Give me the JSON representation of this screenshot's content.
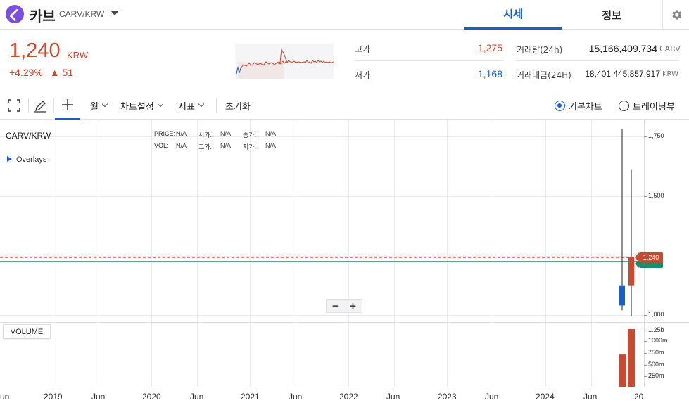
{
  "header": {
    "coin_name": "카브",
    "pair": "CARV/KRW",
    "tabs": [
      "시세",
      "정보"
    ],
    "active_tab": "시세",
    "accent_color": "#1561c8"
  },
  "summary": {
    "price": "1,240",
    "price_unit": "KRW",
    "change_percent": "+4.29%",
    "change_arrow": "▲",
    "change_amount": "51",
    "up_color": "#c84a31",
    "down_color": "#1561c8",
    "high_label": "고가",
    "high_value": "1,275",
    "low_label": "저가",
    "low_value": "1,168",
    "volume_label": "거래량(24h)",
    "volume_value": "15,166,409.734",
    "volume_unit": "CARV",
    "amount_label": "거래대금(24H)",
    "amount_value": "18,401,445,857.917",
    "amount_unit": "KRW"
  },
  "toolbar": {
    "period": "월",
    "chart_settings": "차트설정",
    "indicators": "지표",
    "reset": "초기화",
    "chart_types": [
      "기본차트",
      "트레이딩뷰"
    ],
    "selected_chart_type": "기본차트"
  },
  "chart": {
    "symbol": "CARV/KRW",
    "overlays_label": "Overlays",
    "ohlc_info": [
      {
        "label": "PRICE:",
        "value": "N/A"
      },
      {
        "label": "시가:",
        "value": "N/A"
      },
      {
        "label": "종가:",
        "value": "N/A"
      },
      {
        "label": "VOL:",
        "value": "N/A"
      },
      {
        "label": "고가:",
        "value": "N/A"
      },
      {
        "label": "저가:",
        "value": "N/A"
      }
    ],
    "volume_button": "VOLUME",
    "zoom_minus": "−",
    "zoom_plus": "+",
    "current_price_tag": "1,240"
  },
  "chart_data": {
    "type": "candlestick",
    "price_axis_ticks": [
      "1,750",
      "1,500",
      "1,000"
    ],
    "volume_axis_ticks": [
      "1.25b",
      "1000m",
      "750m",
      "500m",
      "250m"
    ],
    "x_tick_labels": [
      "un",
      "2019",
      "Jun",
      "2020",
      "Jun",
      "2021",
      "Jun",
      "2022",
      "Jun",
      "2023",
      "Jun",
      "2024",
      "Jun",
      "20"
    ],
    "current_price": 1240,
    "moving_average": 1220,
    "candles": [
      {
        "period": "prev",
        "open": 1040,
        "close": 1125,
        "high": 1780,
        "low": 1020,
        "color": "down"
      },
      {
        "period": "last",
        "open": 1125,
        "close": 1245,
        "high": 1610,
        "low": 995,
        "color": "up"
      }
    ],
    "volume": [
      {
        "period": "prev",
        "value": 700000000
      },
      {
        "period": "last",
        "value": 1250000000
      }
    ]
  }
}
